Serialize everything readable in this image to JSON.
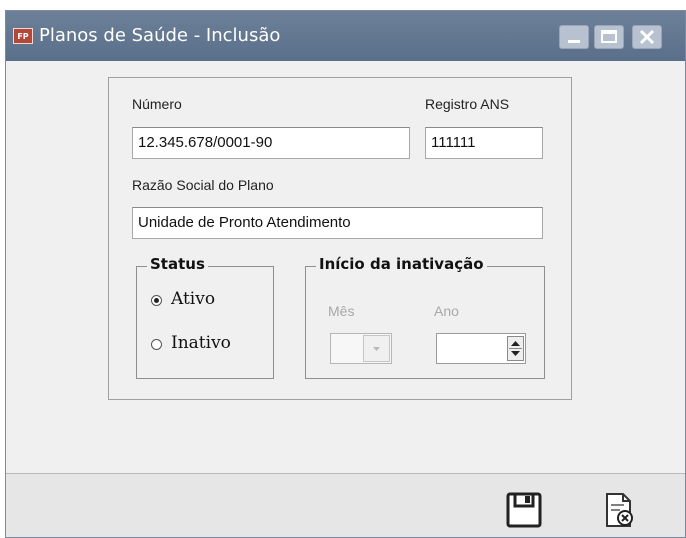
{
  "window": {
    "icon_text": "FP",
    "title": "Planos de Saúde - Inclusão"
  },
  "form": {
    "numero": {
      "label": "Número",
      "value": "12.345.678/0001-90"
    },
    "registro_ans": {
      "label": "Registro ANS",
      "value": "111111"
    },
    "razao_social": {
      "label": "Razão Social do Plano",
      "value": "Unidade de Pronto Atendimento"
    },
    "status": {
      "title": "Status",
      "options": [
        {
          "label": "Ativo",
          "selected": true
        },
        {
          "label": "Inativo",
          "selected": false
        }
      ]
    },
    "inicio_inativacao": {
      "title": "Início da inativação",
      "mes": {
        "label": "Mês",
        "value": ""
      },
      "ano": {
        "label": "Ano",
        "value": ""
      }
    }
  },
  "toolbar": {
    "buttons": [
      {
        "name": "save",
        "icon": "floppy-disk-icon"
      },
      {
        "name": "cancel",
        "icon": "document-close-icon"
      }
    ]
  }
}
